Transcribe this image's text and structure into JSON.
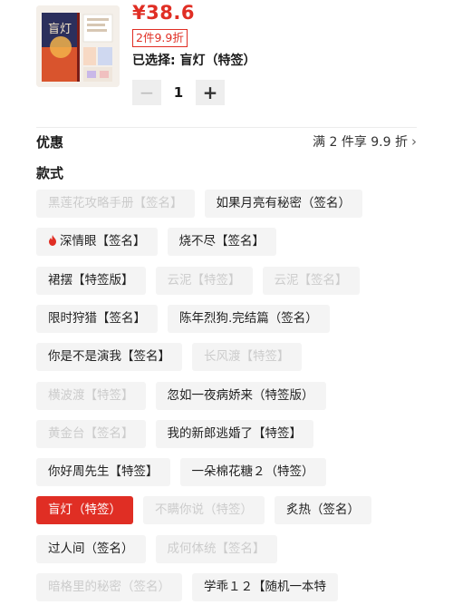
{
  "product": {
    "price": "¥38.6",
    "promo_tag": "2件9.9折",
    "selected_text": "已选择: 盲灯（特签）",
    "quantity": "1",
    "cover_title": "盲灯"
  },
  "promotion": {
    "label": "优惠",
    "value": "满 2 件享 9.9 折"
  },
  "style_section": {
    "label": "款式",
    "rows": [
      [
        {
          "label": "黑莲花攻略手册【签名】",
          "state": "disabled"
        },
        {
          "label": "如果月亮有秘密（签名）",
          "state": "enabled"
        }
      ],
      [
        {
          "label": "深情眼【签名】",
          "state": "enabled",
          "icon": "flame-icon"
        },
        {
          "label": "烧不尽【签名】",
          "state": "enabled"
        }
      ],
      [
        {
          "label": "裙摆【特签版】",
          "state": "enabled"
        },
        {
          "label": "云泥【特签】",
          "state": "disabled"
        },
        {
          "label": "云泥【签名】",
          "state": "disabled"
        }
      ],
      [
        {
          "label": "限时狩猎【签名】",
          "state": "enabled"
        },
        {
          "label": "陈年烈狗.完结篇（签名）",
          "state": "enabled"
        }
      ],
      [
        {
          "label": "你是不是演我【签名】",
          "state": "enabled"
        },
        {
          "label": "长风渡【特签】",
          "state": "disabled"
        }
      ],
      [
        {
          "label": "横波渡【特签】",
          "state": "disabled"
        },
        {
          "label": "忽如一夜病娇来（特签版）",
          "state": "enabled"
        }
      ],
      [
        {
          "label": "黄金台【签名】",
          "state": "disabled"
        },
        {
          "label": "我的新郎逃婚了【特签】",
          "state": "enabled"
        }
      ],
      [
        {
          "label": "你好周先生【特签】",
          "state": "enabled"
        },
        {
          "label": "一朵棉花糖２（特签）",
          "state": "enabled"
        }
      ],
      [
        {
          "label": "盲灯（特签）",
          "state": "selected"
        },
        {
          "label": "不瞒你说（特签）",
          "state": "disabled"
        },
        {
          "label": "炙热（签名）",
          "state": "enabled"
        }
      ],
      [
        {
          "label": "过人间（签名）",
          "state": "enabled"
        },
        {
          "label": "成何体统【签名】",
          "state": "disabled"
        }
      ],
      [
        {
          "label": "暗格里的秘密（签名）",
          "state": "disabled"
        },
        {
          "label": "学乖１２【随机一本特",
          "state": "enabled"
        }
      ]
    ]
  },
  "colors": {
    "accent": "#e02e24",
    "chip_bg": "#f4f4f4",
    "disabled_text": "#cccccc"
  }
}
